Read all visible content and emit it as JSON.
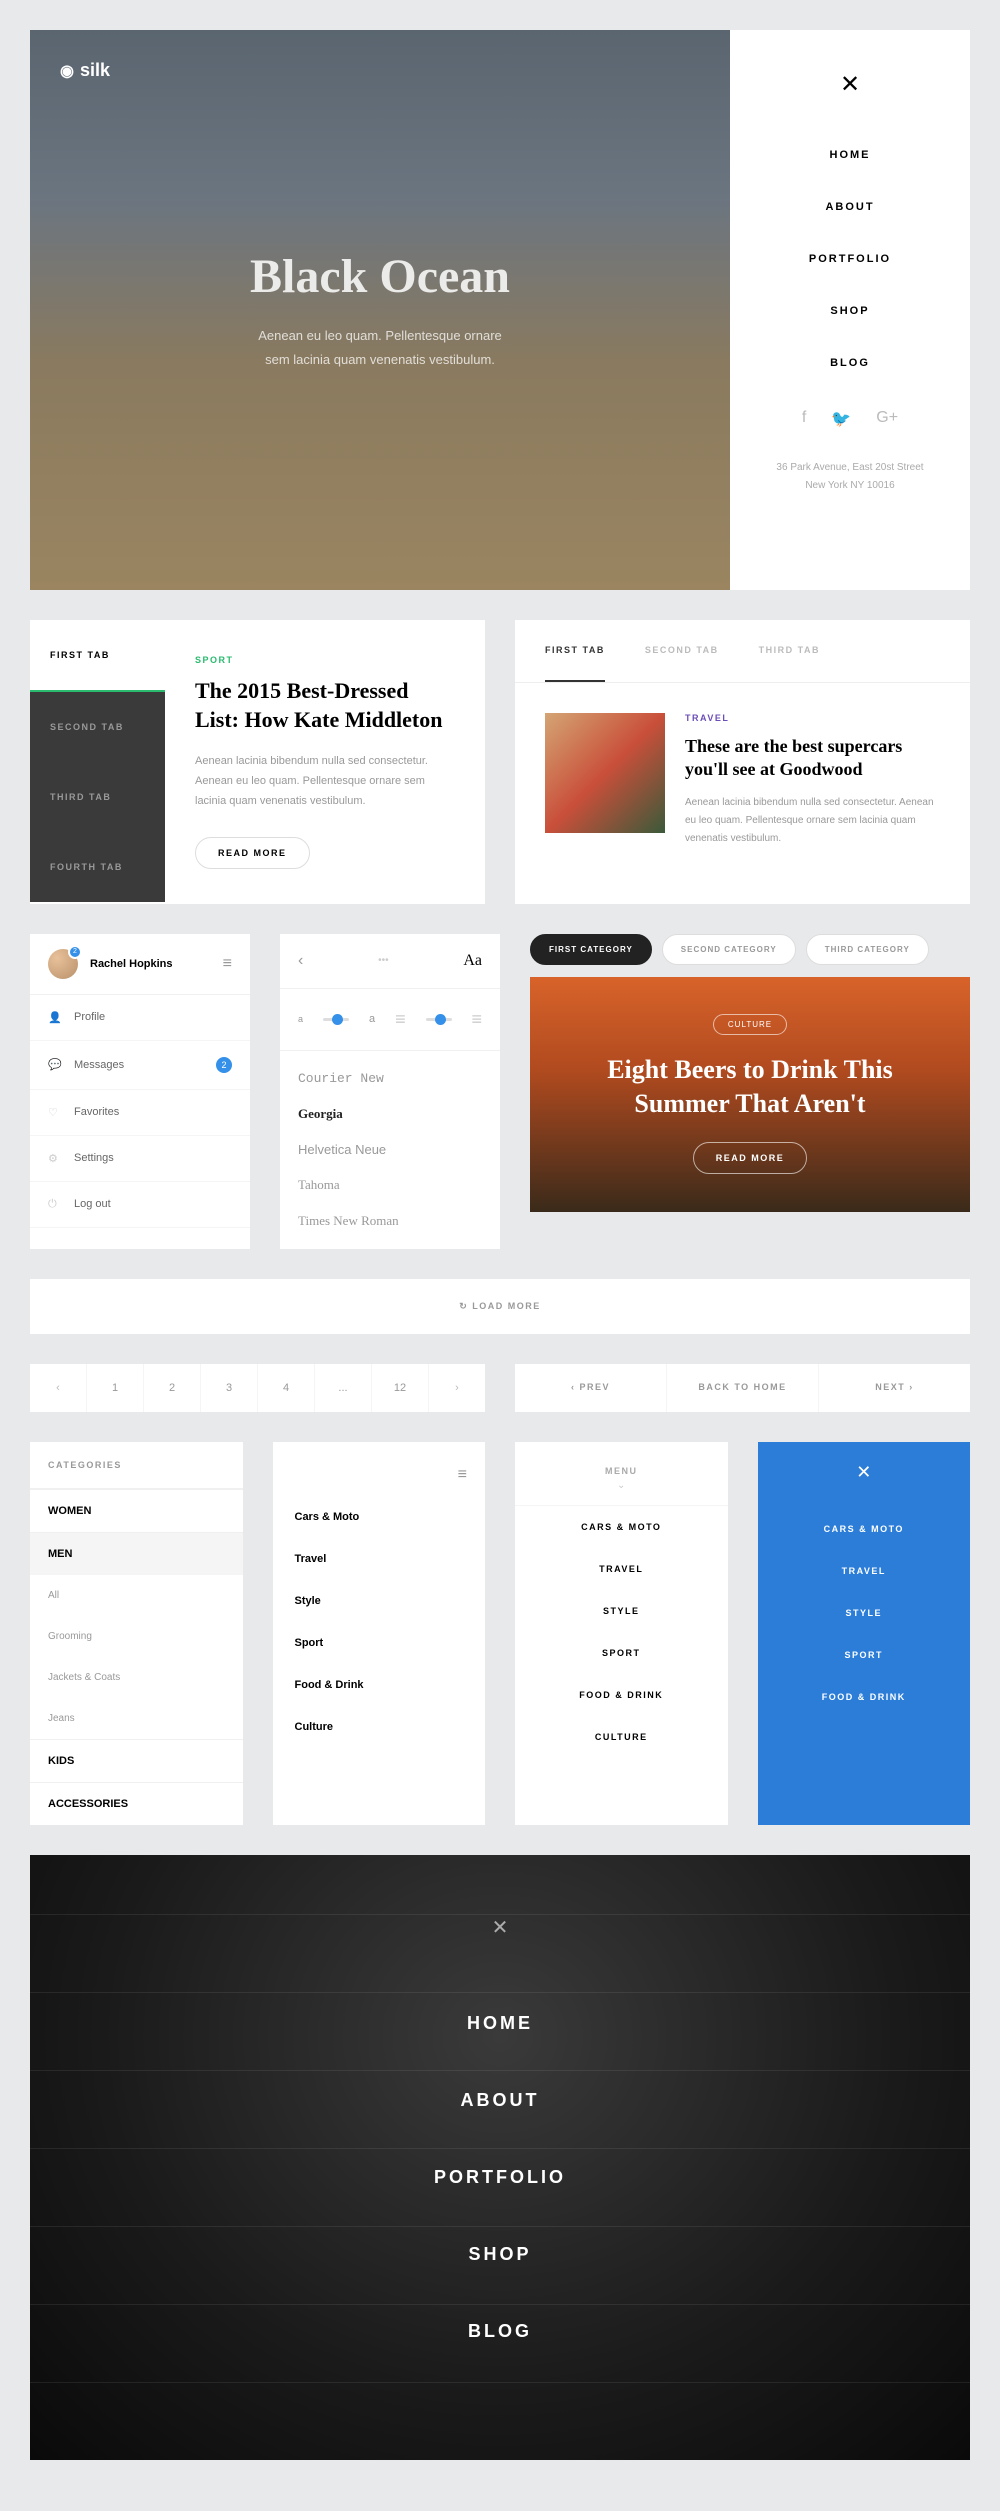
{
  "hero": {
    "logo": "silk",
    "title": "Black Ocean",
    "subtitle1": "Aenean eu leo quam. Pellentesque ornare",
    "subtitle2": "sem lacinia quam venenatis vestibulum.",
    "nav": [
      "HOME",
      "ABOUT",
      "PORTFOLIO",
      "SHOP",
      "BLOG"
    ],
    "address1": "36 Park Avenue, East 20st Street",
    "address2": "New York NY 10016"
  },
  "vtabs": {
    "items": [
      "FIRST TAB",
      "SECOND TAB",
      "THIRD TAB",
      "FOURTH TAB"
    ],
    "category": "SPORT",
    "title": "The 2015 Best-Dressed List: How Kate Middleton",
    "body": "Aenean lacinia bibendum nulla sed consectetur. Aenean eu leo quam. Pellentesque ornare sem lacinia quam venenatis vestibulum.",
    "cta": "READ MORE"
  },
  "htabs": {
    "items": [
      "FIRST TAB",
      "SECOND TAB",
      "THIRD TAB"
    ],
    "category": "TRAVEL",
    "title": "These are the best supercars you'll see at Goodwood",
    "body": "Aenean lacinia bibendum nulla sed consectetur. Aenean eu leo quam. Pellentesque ornare sem lacinia quam venenatis vestibulum."
  },
  "profile": {
    "name": "Rachel Hopkins",
    "badge": "2",
    "items": [
      "Profile",
      "Messages",
      "Favorites",
      "Settings",
      "Log out"
    ],
    "msg_count": "2"
  },
  "fonts": {
    "aa": "Aa",
    "dots": "•••",
    "list": [
      "Courier New",
      "Georgia",
      "Helvetica Neue",
      "Tahoma",
      "Times New Roman"
    ]
  },
  "feature": {
    "pills": [
      "FIRST CATEGORY",
      "SECOND CATEGORY",
      "THIRD CATEGORY"
    ],
    "category": "CULTURE",
    "title": "Eight Beers to Drink This Summer That Aren't",
    "cta": "READ MORE"
  },
  "loadmore": "LOAD MORE",
  "pager": [
    "‹",
    "1",
    "2",
    "3",
    "4",
    "...",
    "12",
    "›"
  ],
  "navpager": [
    "‹  PREV",
    "BACK TO HOME",
    "NEXT  ›"
  ],
  "categories": {
    "head": "CATEGORIES",
    "women": "WOMEN",
    "men": "MEN",
    "subs": [
      "All",
      "Grooming",
      "Jackets & Coats",
      "Jeans"
    ],
    "kids": "KIDS",
    "accessories": "ACCESSORIES"
  },
  "list_items": [
    "Cars & Moto",
    "Travel",
    "Style",
    "Sport",
    "Food & Drink",
    "Culture"
  ],
  "menu": {
    "head": "MENU",
    "items": [
      "CARS & MOTO",
      "TRAVEL",
      "STYLE",
      "SPORT",
      "FOOD & DRINK",
      "CULTURE"
    ]
  },
  "blue": {
    "items": [
      "CARS & MOTO",
      "TRAVEL",
      "STYLE",
      "SPORT",
      "FOOD & DRINK"
    ]
  },
  "overlay": {
    "nav": [
      "HOME",
      "ABOUT",
      "PORTFOLIO",
      "SHOP",
      "BLOG"
    ]
  }
}
